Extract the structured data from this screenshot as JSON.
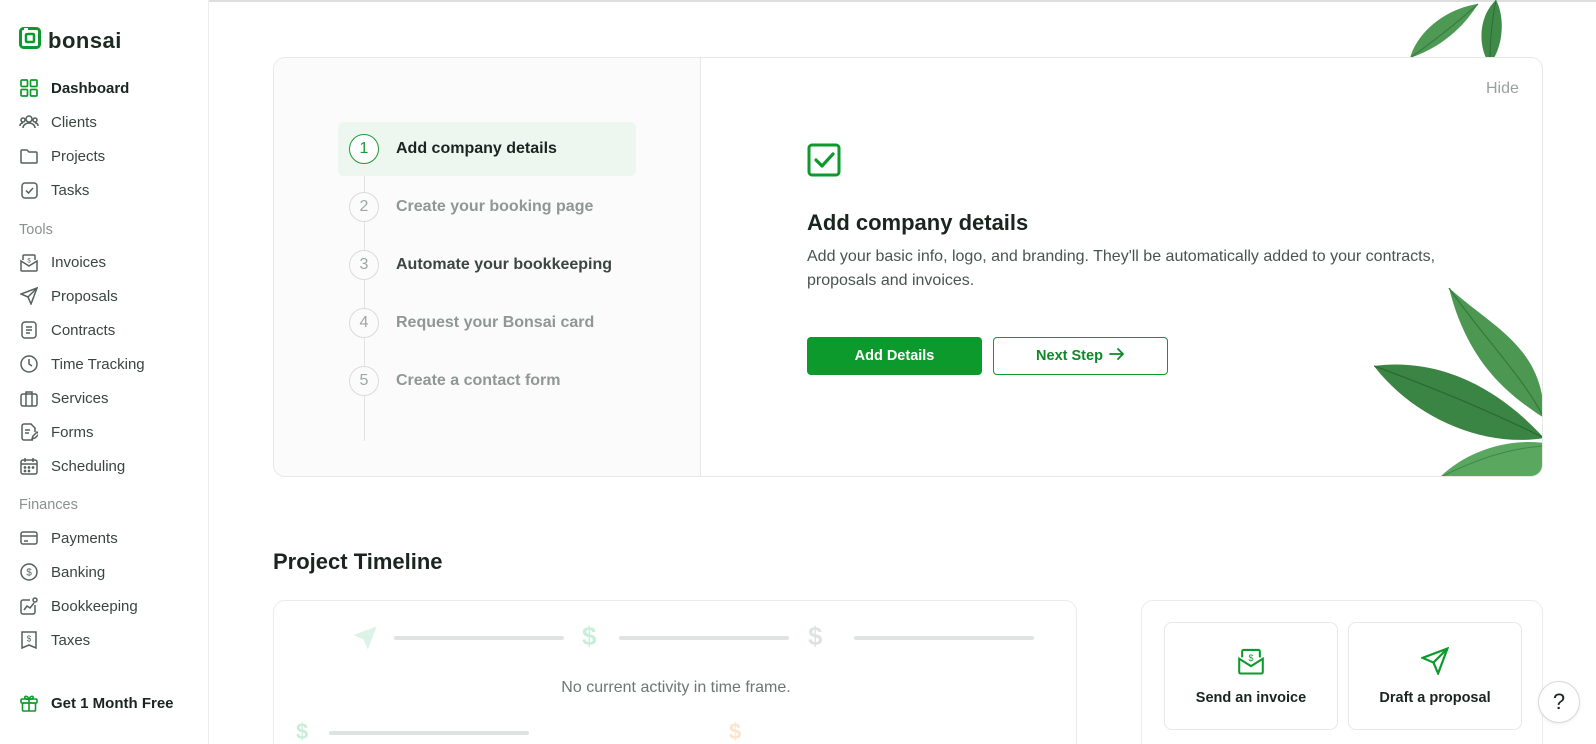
{
  "brand": {
    "name": "bonsai"
  },
  "sidebar": {
    "main_items": [
      {
        "label": "Dashboard",
        "icon": "grid-icon",
        "active": true
      },
      {
        "label": "Clients",
        "icon": "users-icon"
      },
      {
        "label": "Projects",
        "icon": "folder-icon"
      },
      {
        "label": "Tasks",
        "icon": "checkbox-icon"
      }
    ],
    "tools_label": "Tools",
    "tools_items": [
      {
        "label": "Invoices",
        "icon": "invoice-icon"
      },
      {
        "label": "Proposals",
        "icon": "send-icon"
      },
      {
        "label": "Contracts",
        "icon": "document-icon"
      },
      {
        "label": "Time Tracking",
        "icon": "clock-icon"
      },
      {
        "label": "Services",
        "icon": "briefcase-icon"
      },
      {
        "label": "Forms",
        "icon": "form-icon"
      },
      {
        "label": "Scheduling",
        "icon": "calendar-icon"
      }
    ],
    "finances_label": "Finances",
    "finances_items": [
      {
        "label": "Payments",
        "icon": "card-icon"
      },
      {
        "label": "Banking",
        "icon": "dollar-circle-icon"
      },
      {
        "label": "Bookkeeping",
        "icon": "chart-icon"
      },
      {
        "label": "Taxes",
        "icon": "tax-icon"
      }
    ],
    "promo": {
      "label": "Get 1 Month Free",
      "icon": "gift-icon"
    }
  },
  "onboarding": {
    "hide_label": "Hide",
    "steps": [
      {
        "number": "1",
        "label": "Add company details",
        "state": "active"
      },
      {
        "number": "2",
        "label": "Create your booking page",
        "state": "muted"
      },
      {
        "number": "3",
        "label": "Automate your bookkeeping",
        "state": "dark"
      },
      {
        "number": "4",
        "label": "Request your Bonsai card",
        "state": "muted"
      },
      {
        "number": "5",
        "label": "Create a contact form",
        "state": "muted"
      }
    ],
    "detail": {
      "icon": "checkbox-checked-icon",
      "title": "Add company details",
      "description": "Add your basic info, logo, and branding. They'll be automatically added to your contracts, proposals and invoices.",
      "primary_button": "Add Details",
      "secondary_button": "Next Step"
    }
  },
  "timeline": {
    "title": "Project Timeline",
    "empty_message": "No current activity in time frame."
  },
  "quick_actions": [
    {
      "label": "Send an invoice",
      "icon": "invoice-icon"
    },
    {
      "label": "Draft a proposal",
      "icon": "send-icon"
    }
  ],
  "help": {
    "label": "?"
  },
  "colors": {
    "accent": "#0d9a2c",
    "active_bg": "#edf6ef",
    "muted_text": "#8f9894"
  }
}
